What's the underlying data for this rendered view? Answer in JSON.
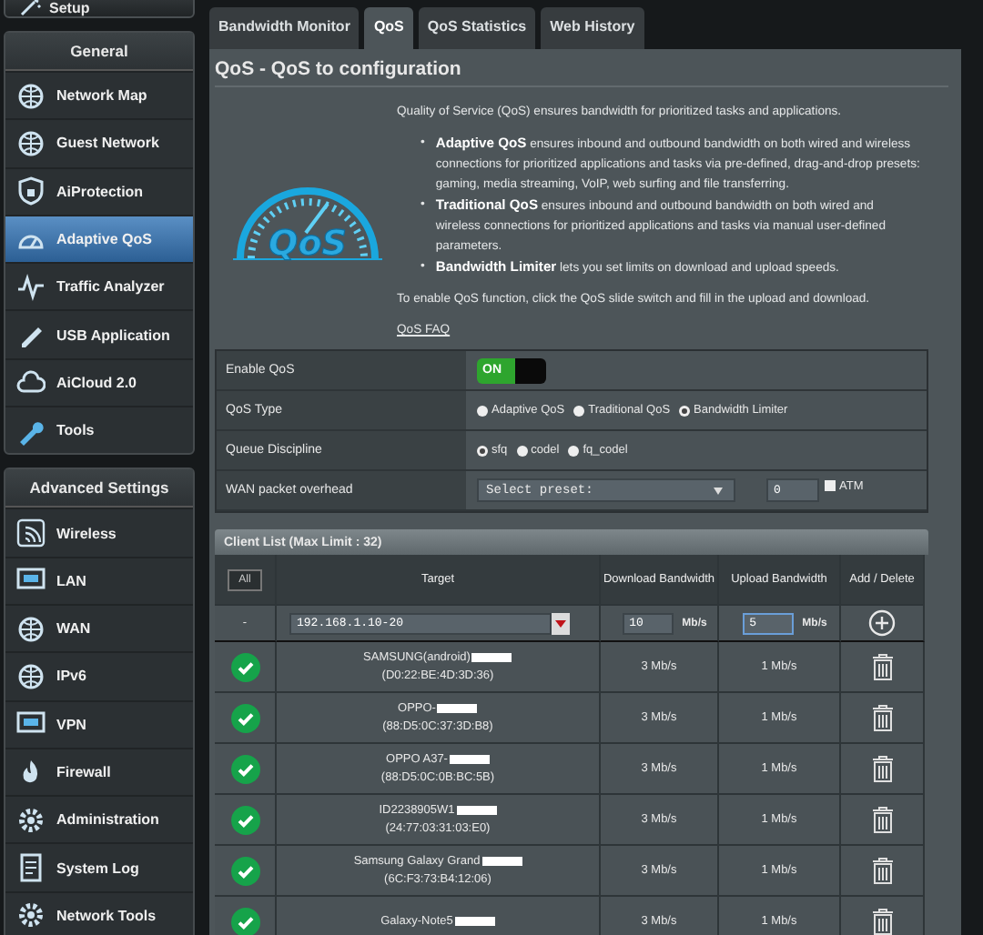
{
  "sidebar": {
    "top_button": "Setup",
    "sections": [
      {
        "title": "General",
        "items": [
          {
            "label": "Network Map",
            "selected": false
          },
          {
            "label": "Guest Network",
            "selected": false
          },
          {
            "label": "AiProtection",
            "selected": false
          },
          {
            "label": "Adaptive QoS",
            "selected": true
          },
          {
            "label": "Traffic Analyzer",
            "selected": false
          },
          {
            "label": "USB Application",
            "selected": false
          },
          {
            "label": "AiCloud 2.0",
            "selected": false
          },
          {
            "label": "Tools",
            "selected": false
          }
        ]
      },
      {
        "title": "Advanced Settings",
        "items": [
          {
            "label": "Wireless",
            "selected": false
          },
          {
            "label": "LAN",
            "selected": false
          },
          {
            "label": "WAN",
            "selected": false
          },
          {
            "label": "IPv6",
            "selected": false
          },
          {
            "label": "VPN",
            "selected": false
          },
          {
            "label": "Firewall",
            "selected": false
          },
          {
            "label": "Administration",
            "selected": false
          },
          {
            "label": "System Log",
            "selected": false
          },
          {
            "label": "Network Tools",
            "selected": false
          }
        ]
      }
    ]
  },
  "tabs": [
    {
      "label": "Bandwidth Monitor",
      "selected": false
    },
    {
      "label": "QoS",
      "selected": true
    },
    {
      "label": "QoS Statistics",
      "selected": false
    },
    {
      "label": "Web History",
      "selected": false
    }
  ],
  "panel": {
    "title": "QoS - QoS to configuration",
    "logo_text": "QoS",
    "intro": "Quality of Service (QoS) ensures bandwidth for prioritized tasks and applications.",
    "bullet": "•",
    "bullets": [
      "**Adaptive QoS** ensures inbound and outbound bandwidth on both wired and wireless connections for prioritized applications and tasks via pre-defined, drag-and-drop presets: gaming, media streaming, VoIP, web surfing and file transferring.",
      "**Traditional QoS** ensures inbound and outbound bandwidth on both wired and wireless connections for prioritized applications and tasks via manual user-defined parameters.",
      "**Bandwidth Limiter** lets you set limits on download and upload speeds."
    ],
    "note": "To enable QoS function, click the QoS slide switch and fill in the upload and download.",
    "faq_link": "QoS FAQ"
  },
  "settings": [
    {
      "kind": "switch",
      "label": "Enable QoS",
      "on": true,
      "on_text": "ON"
    },
    {
      "kind": "radio",
      "label": "QoS Type",
      "options": [
        {
          "label": "Adaptive QoS",
          "selected": false
        },
        {
          "label": "Traditional QoS",
          "selected": false
        },
        {
          "label": "Bandwidth Limiter",
          "selected": true
        }
      ]
    },
    {
      "kind": "radio",
      "label": "Queue Discipline",
      "options": [
        {
          "label": "sfq",
          "selected": true
        },
        {
          "label": "codel",
          "selected": false
        },
        {
          "label": "fq_codel",
          "selected": false
        }
      ]
    },
    {
      "kind": "overhead",
      "label": "WAN packet overhead",
      "preset": "Select preset:",
      "value": "0",
      "checkbox_label": "ATM",
      "checked": false
    }
  ],
  "client_list": {
    "title": "Client List (Max Limit : 32)",
    "all_button": "All",
    "columns": [
      "Target",
      "Download Bandwidth",
      "Upload Bandwidth",
      "Add / Delete"
    ],
    "new_row": {
      "marker": "-",
      "target": "192.168.1.10-20",
      "download": "10",
      "download_unit": "Mb/s",
      "upload": "5",
      "upload_unit": "Mb/s"
    },
    "rows": [
      {
        "enabled": true,
        "name": "SAMSUNG(android)",
        "redacted": true,
        "mac": "(D0:22:BE:4D:3D:36)",
        "download": "3 Mb/s",
        "upload": "1 Mb/s"
      },
      {
        "enabled": true,
        "name": "OPPO-",
        "redacted": true,
        "mac": "(88:D5:0C:37:3D:B8)",
        "download": "3 Mb/s",
        "upload": "1 Mb/s"
      },
      {
        "enabled": true,
        "name": "OPPO A37-",
        "redacted": true,
        "mac": "(88:D5:0C:0B:BC:5B)",
        "download": "3 Mb/s",
        "upload": "1 Mb/s"
      },
      {
        "enabled": true,
        "name": "ID2238905W1",
        "redacted": true,
        "mac": "(24:77:03:31:03:E0)",
        "download": "3 Mb/s",
        "upload": "1 Mb/s"
      },
      {
        "enabled": true,
        "name": "Samsung Galaxy Grand",
        "redacted": true,
        "mac": "(6C:F3:73:B4:12:06)",
        "download": "3 Mb/s",
        "upload": "1 Mb/s"
      },
      {
        "enabled": true,
        "name": "Galaxy-Note5",
        "redacted": true,
        "download": "3 Mb/s",
        "upload": "1 Mb/s"
      }
    ]
  }
}
